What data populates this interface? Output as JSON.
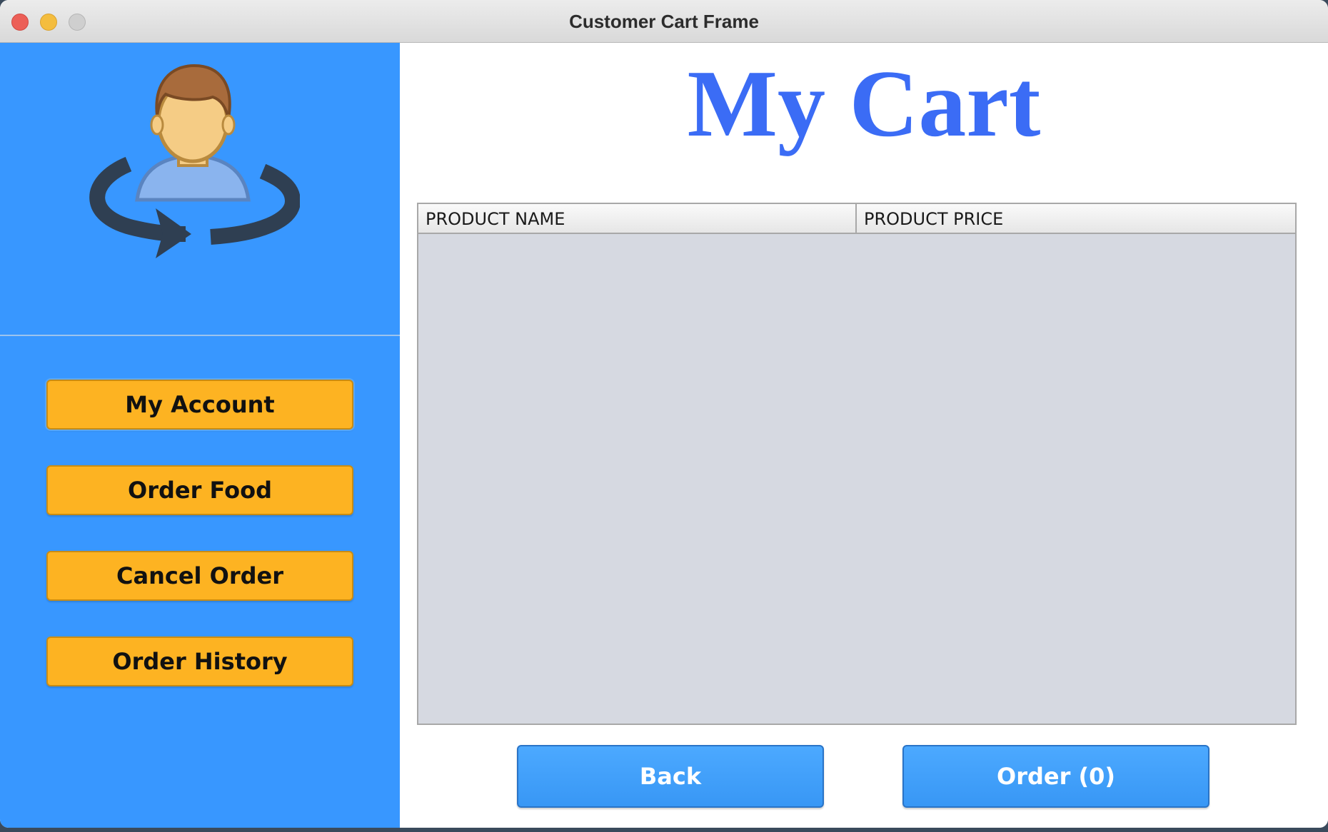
{
  "window": {
    "title": "Customer Cart Frame",
    "controls": [
      "close",
      "minimize",
      "maximize"
    ]
  },
  "sidebar": {
    "avatar_icon": "user-refresh-icon",
    "background_color": "#3897ff",
    "buttons": [
      {
        "label": "My Account"
      },
      {
        "label": "Order Food"
      },
      {
        "label": "Cancel Order"
      },
      {
        "label": "Order History"
      }
    ],
    "button_color": "#fdb322"
  },
  "main": {
    "heading": "My Cart",
    "heading_color": "#3b6cf5",
    "table": {
      "columns": [
        "PRODUCT NAME",
        "PRODUCT PRICE"
      ],
      "rows": []
    },
    "back_label": "Back",
    "order_label": "Order (0)",
    "button_color": "#3897f5"
  }
}
